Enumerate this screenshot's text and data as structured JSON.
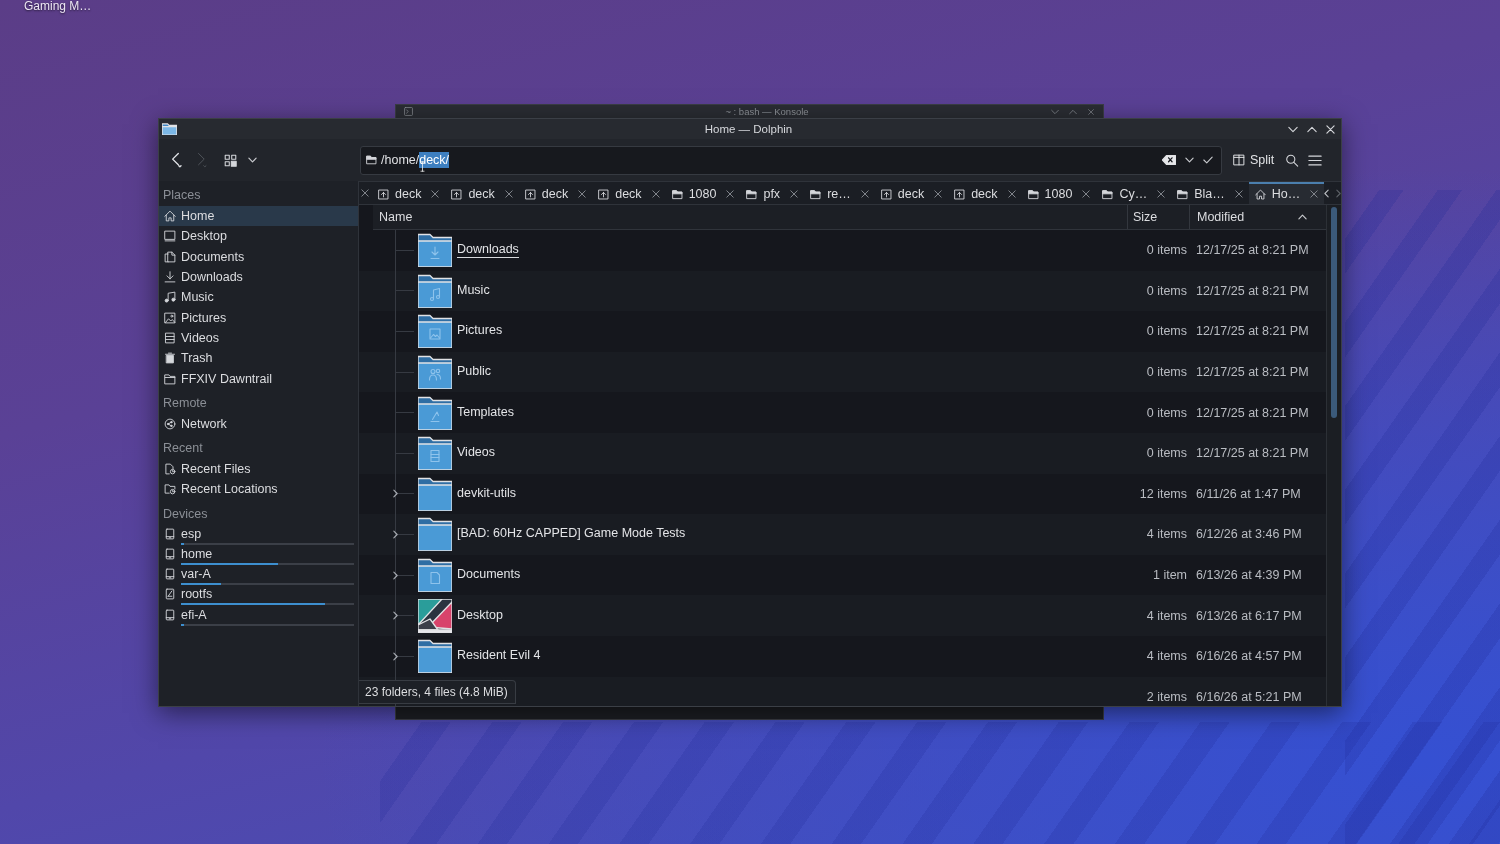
{
  "desktop": {
    "icon_label": "Gaming M…"
  },
  "background_window": {
    "title": "~ : bash — Konsole"
  },
  "window": {
    "title": "Home — Dolphin"
  },
  "toolbar": {
    "nav": [
      {
        "kind": "back",
        "disabled": false
      },
      {
        "kind": "forward",
        "disabled": true
      }
    ],
    "location": {
      "path": "/home/",
      "selection": "deck/"
    },
    "split_button": "Split"
  },
  "sidebar": {
    "sections": [
      {
        "heading": "Places",
        "items": [
          {
            "label": "Home",
            "kind": "home",
            "selected": true
          },
          {
            "label": "Desktop",
            "kind": "desktop",
            "selected": false
          },
          {
            "label": "Documents",
            "kind": "documents",
            "selected": false
          },
          {
            "label": "Downloads",
            "kind": "downloads",
            "selected": false
          },
          {
            "label": "Music",
            "kind": "music",
            "selected": false
          },
          {
            "label": "Pictures",
            "kind": "pictures",
            "selected": false
          },
          {
            "label": "Videos",
            "kind": "videos",
            "selected": false
          },
          {
            "label": "Trash",
            "kind": "trash",
            "selected": false
          },
          {
            "label": "FFXIV Dawntrail",
            "kind": "folder",
            "selected": false
          }
        ]
      },
      {
        "heading": "Remote",
        "items": [
          {
            "label": "Network",
            "kind": "network",
            "selected": false
          }
        ]
      },
      {
        "heading": "Recent",
        "items": [
          {
            "label": "Recent Files",
            "kind": "recent_files",
            "selected": false
          },
          {
            "label": "Recent Locations",
            "kind": "recent_locations",
            "selected": false
          }
        ]
      },
      {
        "heading": "Devices",
        "items": [
          {
            "label": "esp",
            "kind": "drive",
            "selected": false,
            "level": 0.02
          },
          {
            "label": "home",
            "kind": "drive",
            "selected": false,
            "level": 0.56
          },
          {
            "label": "var-A",
            "kind": "drive",
            "selected": false,
            "level": 0.23
          },
          {
            "label": "rootfs",
            "kind": "drive_root",
            "selected": false,
            "level": 0.83
          },
          {
            "label": "efi-A",
            "kind": "drive",
            "selected": false,
            "level": 0.02
          }
        ]
      }
    ]
  },
  "tabs": [
    {
      "label": "deck",
      "kind": "drive",
      "selected": false
    },
    {
      "label": "deck",
      "kind": "drive",
      "selected": false
    },
    {
      "label": "deck",
      "kind": "drive",
      "selected": false
    },
    {
      "label": "deck",
      "kind": "drive",
      "selected": false
    },
    {
      "label": "1080",
      "kind": "folder",
      "selected": false
    },
    {
      "label": "pfx",
      "kind": "folder",
      "selected": false
    },
    {
      "label": "re…",
      "kind": "folder",
      "selected": false
    },
    {
      "label": "deck",
      "kind": "drive",
      "selected": false
    },
    {
      "label": "deck",
      "kind": "drive",
      "selected": false
    },
    {
      "label": "1080",
      "kind": "folder",
      "selected": false
    },
    {
      "label": "Cy…",
      "kind": "folder",
      "selected": false
    },
    {
      "label": "Bla…",
      "kind": "folder",
      "selected": false
    },
    {
      "label": "Ho…",
      "kind": "home",
      "selected": true
    }
  ],
  "table": {
    "columns": [
      {
        "label": "Name",
        "sorted": false
      },
      {
        "label": "Size",
        "sorted": false
      },
      {
        "label": "Modified",
        "sorted": true
      }
    ],
    "rows": [
      {
        "name": "Downloads",
        "kind": "downloads",
        "expandable": false,
        "hovered": true,
        "size": "0 items",
        "modified": "12/17/25 at 8:21 PM"
      },
      {
        "name": "Music",
        "kind": "music",
        "expandable": false,
        "hovered": false,
        "size": "0 items",
        "modified": "12/17/25 at 8:21 PM"
      },
      {
        "name": "Pictures",
        "kind": "pictures",
        "expandable": false,
        "hovered": false,
        "size": "0 items",
        "modified": "12/17/25 at 8:21 PM"
      },
      {
        "name": "Public",
        "kind": "public",
        "expandable": false,
        "hovered": false,
        "size": "0 items",
        "modified": "12/17/25 at 8:21 PM"
      },
      {
        "name": "Templates",
        "kind": "templates",
        "expandable": false,
        "hovered": false,
        "size": "0 items",
        "modified": "12/17/25 at 8:21 PM"
      },
      {
        "name": "Videos",
        "kind": "videos",
        "expandable": false,
        "hovered": false,
        "size": "0 items",
        "modified": "12/17/25 at 8:21 PM"
      },
      {
        "name": "devkit-utils",
        "kind": "folder",
        "expandable": true,
        "hovered": false,
        "size": "12 items",
        "modified": "6/11/26 at 1:47 PM"
      },
      {
        "name": "[BAD: 60Hz CAPPED] Game Mode Tests",
        "kind": "folder",
        "expandable": true,
        "hovered": false,
        "size": "4 items",
        "modified": "6/12/26 at 3:46 PM"
      },
      {
        "name": "Documents",
        "kind": "documents",
        "expandable": true,
        "hovered": false,
        "size": "1 item",
        "modified": "6/13/26 at 4:39 PM"
      },
      {
        "name": "Desktop",
        "kind": "thumbnail",
        "expandable": true,
        "hovered": false,
        "size": "4 items",
        "modified": "6/13/26 at 6:17 PM"
      },
      {
        "name": "Resident Evil 4",
        "kind": "folder",
        "expandable": true,
        "hovered": false,
        "size": "4 items",
        "modified": "6/16/26 at 4:57 PM"
      },
      {
        "size": "2 items",
        "modified": "6/16/26 at 5:21 PM"
      }
    ]
  },
  "status_bar": {
    "text": "23 folders, 4 files (4.8 MiB)"
  }
}
